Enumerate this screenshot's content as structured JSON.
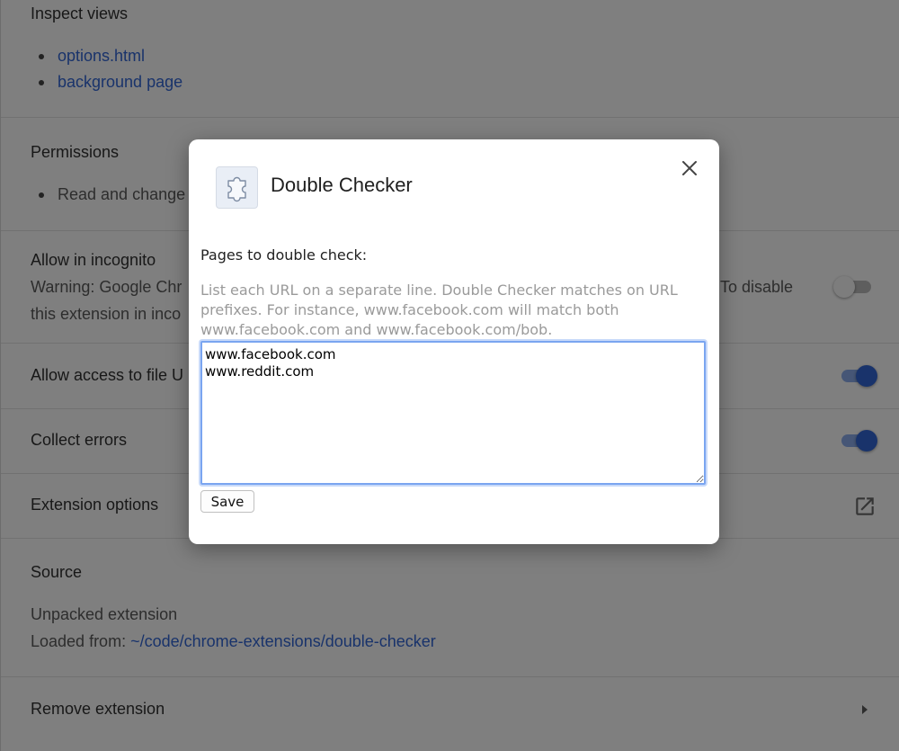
{
  "inspect_views": {
    "title": "Inspect views",
    "links": [
      "options.html",
      "background page"
    ]
  },
  "permissions": {
    "title": "Permissions",
    "items": [
      "Read and change"
    ]
  },
  "incognito": {
    "title": "Allow in incognito",
    "warning_line1_left": "Warning: Google Chr",
    "warning_line1_right": "To disable",
    "warning_line2": "this extension in inco",
    "enabled": false
  },
  "file_urls": {
    "title": "Allow access to file U",
    "enabled": true
  },
  "collect_errors": {
    "title": "Collect errors",
    "enabled": true
  },
  "extension_options": {
    "title": "Extension options",
    "icon": "open-in-new-icon"
  },
  "source": {
    "title": "Source",
    "type": "Unpacked extension",
    "loaded_from_label": "Loaded from:",
    "path": "~/code/chrome-extensions/double-checker"
  },
  "remove_extension": {
    "title": "Remove extension",
    "icon": "chevron-right-icon"
  },
  "dialog": {
    "title": "Double Checker",
    "icon": "puzzle-piece-icon",
    "close_icon": "close-icon",
    "field_label": "Pages to double check:",
    "hint": "List each URL on a separate line. Double Checker matches on URL prefixes. For instance, www.facebook.com will match both www.facebook.com and www.facebook.com/bob.",
    "urls_value": "www.facebook.com\nwww.reddit.com",
    "save_label": "Save"
  },
  "colors": {
    "accent": "#3367d6",
    "link": "#3367d6",
    "overlay": "rgba(0,0,0,0.5)",
    "toggle_on_track": "#8cadec",
    "focus_ring": "#7aa5f0"
  }
}
